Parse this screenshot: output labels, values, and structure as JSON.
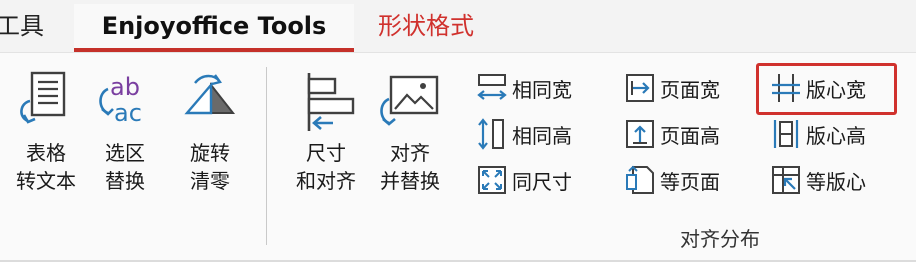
{
  "tabs": {
    "tools": "工具",
    "enjoyoffice": "Enjoyoffice Tools",
    "shape_format": "形状格式"
  },
  "buttons": {
    "table_to_text": [
      "表格",
      "转文本"
    ],
    "select_replace": [
      "选区",
      "替换"
    ],
    "rotate_zero": [
      "旋转",
      "清零"
    ],
    "size_align": [
      "尺寸",
      "和对齐"
    ],
    "align_replace": [
      "对齐",
      "并替换"
    ]
  },
  "small_buttons": {
    "same_width": "相同宽",
    "same_height": "相同高",
    "same_size": "同尺寸",
    "page_width": "页面宽",
    "page_height": "页面高",
    "equal_page": "等页面",
    "layout_width": "版心宽",
    "layout_height": "版心高",
    "equal_layout": "等版心"
  },
  "group_label": "对齐分布",
  "colors": {
    "accent": "#d0312d",
    "icon_blue": "#2a7ab8",
    "icon_dark": "#404040"
  }
}
